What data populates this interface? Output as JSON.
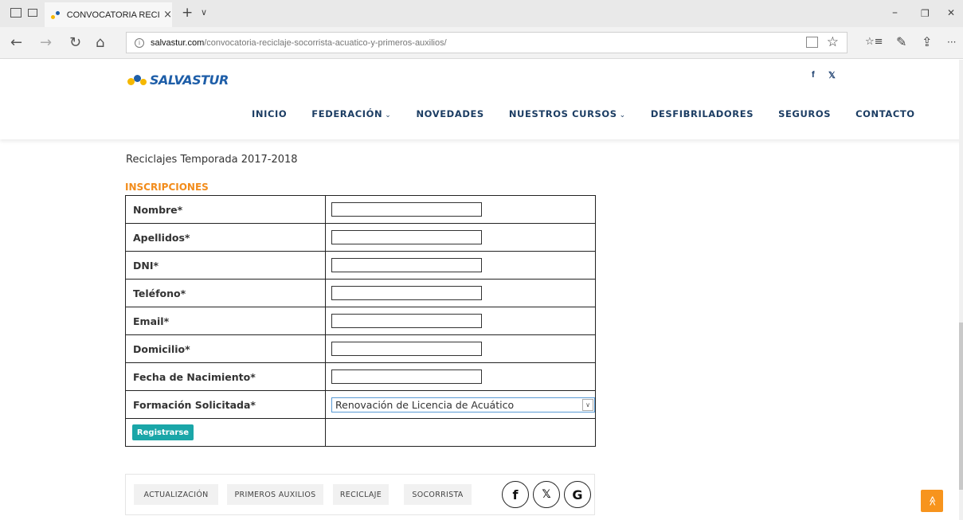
{
  "browser": {
    "tab_title": "CONVOCATORIA RECICL",
    "tab_close": "×",
    "new_tab": "+",
    "tab_list": "∨",
    "url_host": "salvastur.com",
    "url_path": "/convocatoria-reciclaje-socorrista-acuatico-y-primeros-auxilios/",
    "back": "←",
    "forward": "→",
    "refresh": "↻",
    "home": "⌂",
    "star": "☆",
    "favorites": "☆≡",
    "notes": "✎",
    "share": "⇪",
    "more": "···",
    "minimize": "–",
    "restore": "❐",
    "close": "✕"
  },
  "site": {
    "logo_text": "SALVASTUR",
    "social": {
      "facebook": "f",
      "twitter": "𝕏"
    },
    "nav": [
      {
        "label": "INICIO"
      },
      {
        "label": "FEDERACIÓN",
        "chevron": "⌄"
      },
      {
        "label": "NOVEDADES"
      },
      {
        "label": "NUESTROS CURSOS",
        "chevron": "⌄"
      },
      {
        "label": "DESFIBRILADORES"
      },
      {
        "label": "SEGUROS"
      },
      {
        "label": "CONTACTO"
      }
    ]
  },
  "content": {
    "season": "Reciclajes Temporada 2017-2018",
    "heading": "INSCRIPCIONES",
    "fields": [
      {
        "label": "Nombre*",
        "value": ""
      },
      {
        "label": "Apellidos*",
        "value": ""
      },
      {
        "label": "DNI*",
        "value": ""
      },
      {
        "label": "Teléfono*",
        "value": ""
      },
      {
        "label": "Email*",
        "value": ""
      },
      {
        "label": "Domicilio*",
        "value": ""
      },
      {
        "label": "Fecha de Nacimiento*",
        "value": ""
      }
    ],
    "select_label": "Formación Solicitada*",
    "select_value": "Renovación de Licencia de Acuático",
    "submit": "Registrarse"
  },
  "tags": [
    "ACTUALIZACIÓN",
    "PRIMEROS AUXILIOS",
    "RECICLAJE",
    "SOCORRISTA"
  ],
  "share_icons": [
    "f",
    "𝕏",
    "G"
  ],
  "to_top": "≫",
  "colors": {
    "nav_text": "#1c3d63",
    "heading_orange": "#f28c1b",
    "button_teal": "#1aa6a8",
    "to_top_orange": "#f7941d",
    "logo_blue": "#1e5ea8"
  }
}
